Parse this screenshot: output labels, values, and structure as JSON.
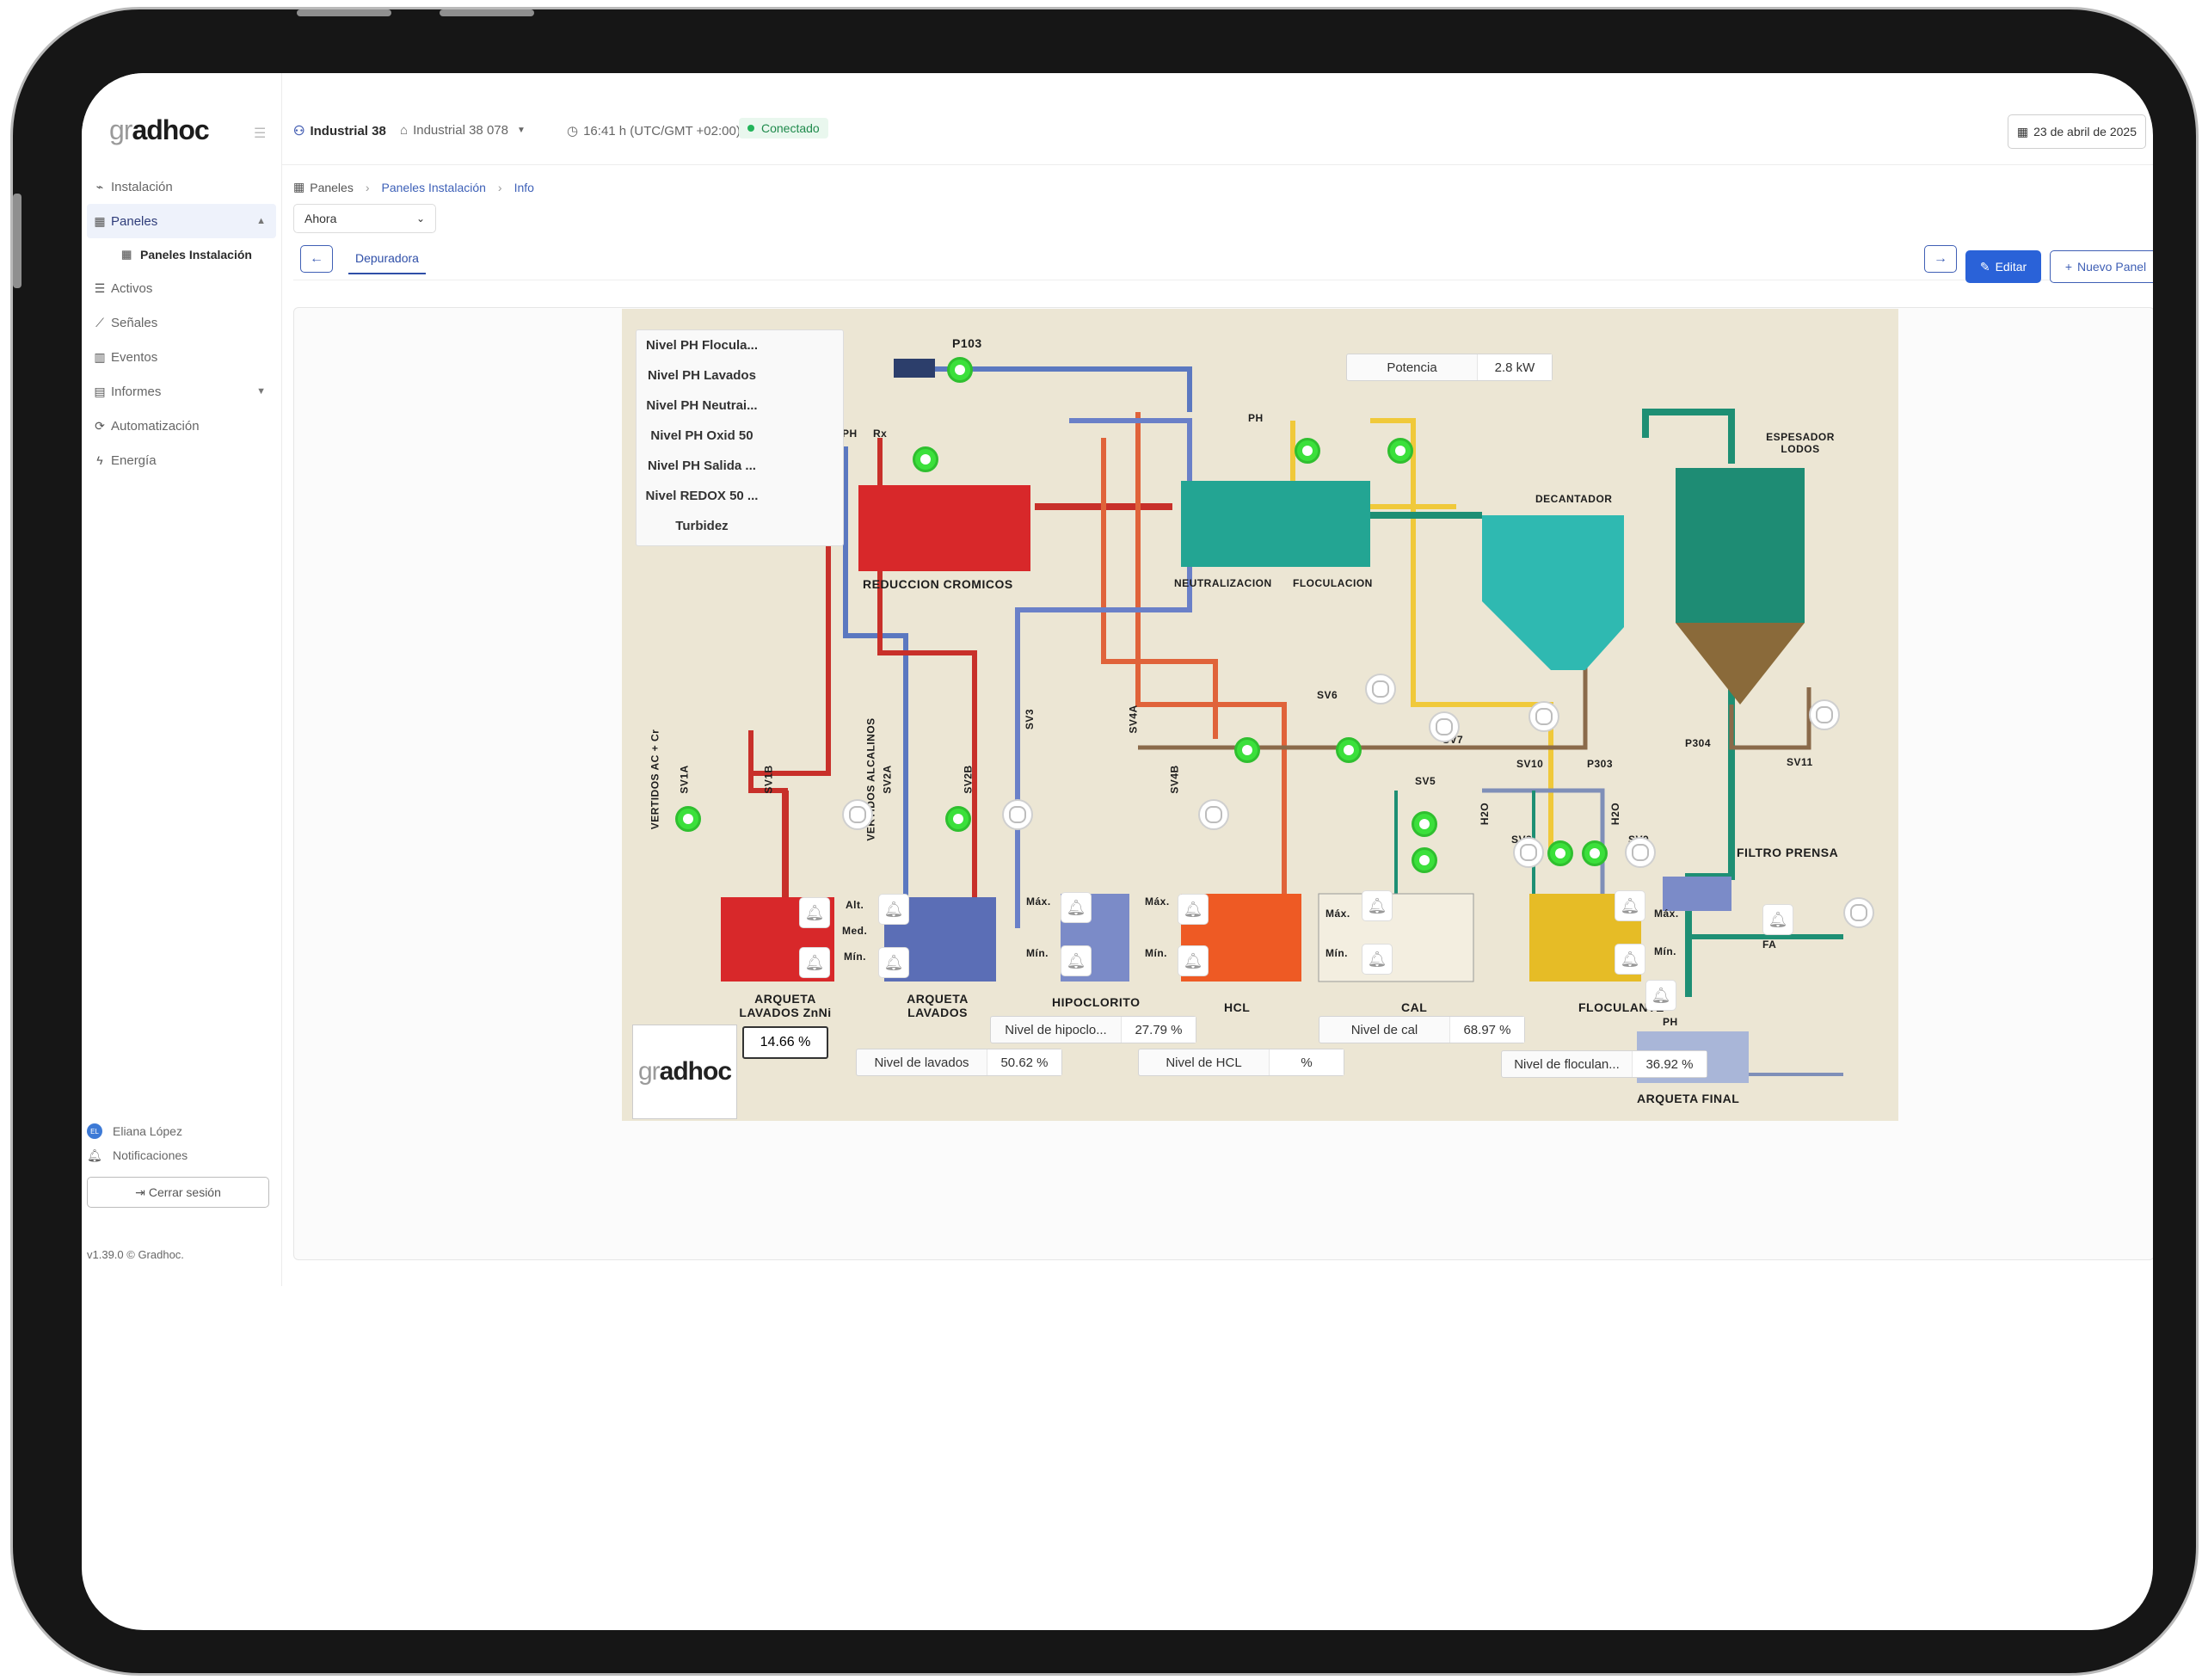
{
  "sidebar": {
    "logo_prefix": "gr",
    "logo_suffix": "adhoc",
    "nav": [
      {
        "label": "Instalación"
      },
      {
        "label": "Paneles",
        "sub": "Paneles Instalación"
      },
      {
        "label": "Activos"
      },
      {
        "label": "Señales"
      },
      {
        "label": "Eventos"
      },
      {
        "label": "Informes"
      },
      {
        "label": "Automatización"
      },
      {
        "label": "Energía"
      }
    ],
    "user_name": "Eliana López",
    "user_initials": "EL",
    "notifications": "Notificaciones",
    "logout": "Cerrar sesión",
    "version": "v1.39.0 © Gradhoc."
  },
  "topbar": {
    "org": "Industrial 38",
    "site": "Industrial 38 078",
    "time": "16:41 h (UTC/GMT +02:00)",
    "status": "Conectado",
    "date": "23 de abril de 2025"
  },
  "breadcrumb": [
    "Paneles",
    "Paneles Instalación",
    "Info"
  ],
  "period": "Ahora",
  "tab": "Depuradora",
  "buttons": {
    "edit": "Editar",
    "new_panel": "Nuevo Panel"
  },
  "colors": {
    "accent": "#2a62d8",
    "status": "#22b45a",
    "indicator_on": "#3be03b"
  },
  "diagram": {
    "level_list": [
      "Nivel PH Flocula...",
      "Nivel PH Lavados",
      "Nivel PH Neutrai...",
      "Nivel PH Oxid 50",
      "Nivel PH Salida ...",
      "Nivel REDOX 50 ...",
      "Turbidez"
    ],
    "readings": [
      {
        "label": "Potencia",
        "value": "2.8 kW"
      },
      {
        "label": "Nivel de hipoclo...",
        "value": "27.79 %"
      },
      {
        "label": "Nivel de lavados",
        "value": "50.62 %"
      },
      {
        "label": "Nivel de HCL",
        "value": "%"
      },
      {
        "label": "Nivel de cal",
        "value": "68.97 %"
      },
      {
        "label": "Nivel de floculan...",
        "value": "36.92 %"
      }
    ],
    "arqueta_level": "14.66 %",
    "labels": {
      "p103": "P103",
      "reduccion": "REDUCCION  CROMICOS",
      "neutralizacion": "NEUTRALIZACION",
      "floculacion": "FLOCULACION",
      "decantador": "DECANTADOR",
      "espesador": "ESPESADOR LODOS",
      "vertidos_ac": "VERTIDOS AC + Cr",
      "vertidos_alc": "VERTIDOS ALCALINOS",
      "arqueta_lavados_znni": "ARQUETA LAVADOS ZnNi",
      "arqueta_lavados": "ARQUETA LAVADOS",
      "hipoclorito": "HIPOCLORITO",
      "hcl": "HCL",
      "cal": "CAL",
      "floculante": "FLOCULANTE",
      "arqueta_final": "ARQUETA FINAL",
      "filtro_prensa": "FILTRO  PRENSA",
      "sv1a": "SV1A",
      "sv1b": "SV1B",
      "sv2a": "SV2A",
      "sv2b": "SV2B",
      "sv3": "SV3",
      "sv4a": "SV4A",
      "sv4b": "SV4B",
      "sv5": "SV5",
      "sv6": "SV6",
      "sv7": "SV7",
      "sv8": "SV8",
      "sv9": "SV9",
      "sv10": "SV10",
      "sv11": "SV11",
      "p303": "P303",
      "p304": "P304",
      "ph": "PH",
      "rx": "Rx",
      "alt": "Alt.",
      "med": "Med.",
      "min": "Mín.",
      "max": "Máx.",
      "h2o": "H2O",
      "fa": "FA"
    }
  }
}
